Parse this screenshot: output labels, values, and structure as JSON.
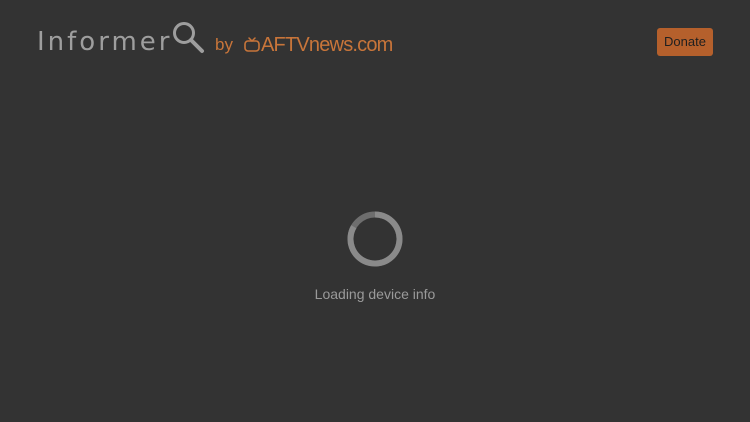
{
  "header": {
    "app_title": "Informer",
    "by_label": "by",
    "brand": "AFTVnews.com",
    "donate_label": "Donate",
    "icons": {
      "search": "magnifier-icon",
      "brand": "tv-icon"
    }
  },
  "main": {
    "loading_text": "Loading device info",
    "spinner_icon": "loading-spinner-icon"
  },
  "colors": {
    "background": "#333333",
    "accent": "#c8753a",
    "donate_bg": "#b5602c",
    "title_text": "#9e9e9e"
  }
}
